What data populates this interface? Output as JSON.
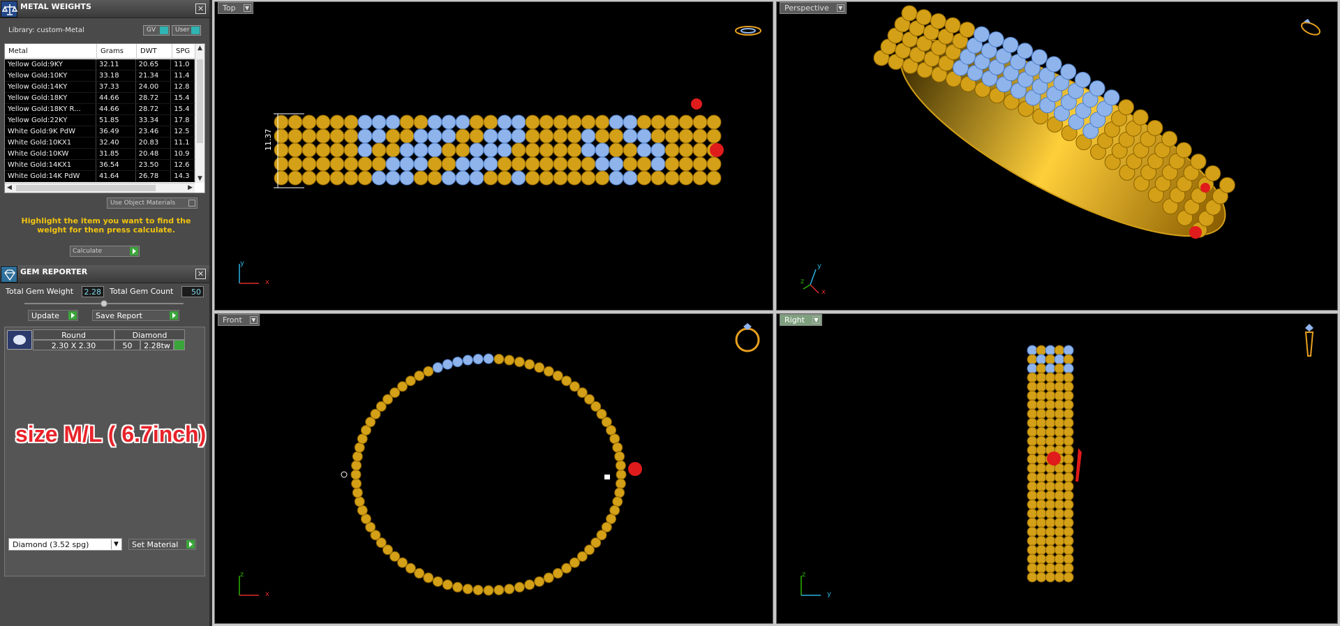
{
  "metal_weights": {
    "title": "METAL WEIGHTS",
    "close": "✕",
    "library_label": "Library: custom-Metal",
    "toggle_gv": "GV",
    "toggle_user": "User",
    "columns": [
      "Metal",
      "Grams",
      "DWT",
      "SPG"
    ],
    "rows": [
      [
        "Yellow Gold:9KY",
        "32.11",
        "20.65",
        "11.0"
      ],
      [
        "Yellow Gold:10KY",
        "33.18",
        "21.34",
        "11.4"
      ],
      [
        "Yellow Gold:14KY",
        "37.33",
        "24.00",
        "12.8"
      ],
      [
        "Yellow Gold:18KY",
        "44.66",
        "28.72",
        "15.4"
      ],
      [
        "Yellow Gold:18KY R...",
        "44.66",
        "28.72",
        "15.4"
      ],
      [
        "Yellow Gold:22KY",
        "51.85",
        "33.34",
        "17.8"
      ],
      [
        "White Gold:9K PdW",
        "36.49",
        "23.46",
        "12.5"
      ],
      [
        "White Gold:10KX1",
        "32.40",
        "20.83",
        "11.1"
      ],
      [
        "White Gold:10KW",
        "31.85",
        "20.48",
        "10.9"
      ],
      [
        "White Gold:14KX1",
        "36.54",
        "23.50",
        "12.6"
      ],
      [
        "White Gold:14K PdW",
        "41.64",
        "26.78",
        "14.3"
      ]
    ],
    "use_object_materials": "Use Object Materials",
    "highlight_message": "Highlight the item you want to find the weight for then press calculate.",
    "calculate_label": "Calculate"
  },
  "gem_reporter": {
    "title": "GEM REPORTER",
    "close": "✕",
    "total_gem_weight_label": "Total Gem Weight",
    "total_gem_weight": "2.28",
    "total_gem_count_label": "Total Gem Count",
    "total_gem_count": "50",
    "update_label": "Update",
    "save_report_label": "Save Report",
    "gem": {
      "shape": "Round",
      "material": "Diamond",
      "size": "2.30 X 2.30",
      "count": "50",
      "weight": "2.28tw"
    },
    "material_select": "Diamond    (3.52 spg)",
    "set_material_label": "Set Material"
  },
  "overlay_text": "size M/L ( 6.7inch)",
  "viewports": {
    "top": {
      "label": "Top",
      "dimension": "11.37",
      "axis_h": "x",
      "axis_v": "y"
    },
    "perspective": {
      "label": "Perspective",
      "axis_x": "x",
      "axis_y": "y",
      "axis_z": "z"
    },
    "front": {
      "label": "Front",
      "axis_h": "x",
      "axis_v": "z"
    },
    "right": {
      "label": "Right",
      "axis_h": "y",
      "axis_v": "z"
    }
  },
  "colors": {
    "gold": "#d4a017",
    "stone": "#8fb4ec",
    "accent_red": "#e01b1b",
    "viewport_bg": "#000000"
  }
}
